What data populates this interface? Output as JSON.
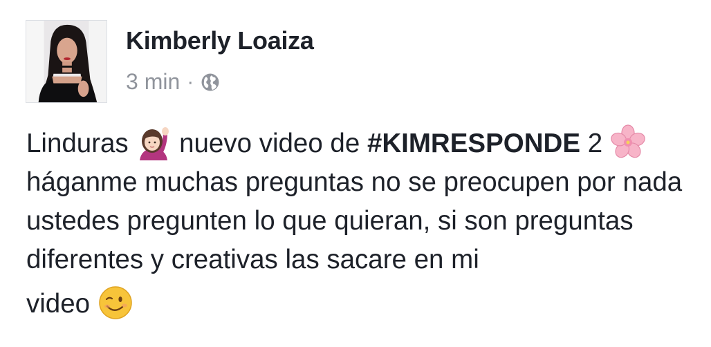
{
  "post": {
    "author": "Kimberly Loaiza",
    "time": "3 min",
    "separator": "·",
    "privacy_icon": "globe-icon",
    "text": {
      "part1": "Linduras",
      "emoji1": "person-raising-hand-emoji",
      "part2": "nuevo video de",
      "hashtag": "#KIMRESPONDE",
      "part3": "2",
      "emoji2": "cherry-blossom-emoji",
      "part4": "háganme muchas preguntas no se preocupen por nada ustedes pregunten lo que quieran, si son preguntas diferentes y creativas las sacare en mi",
      "part5": "video",
      "emoji3": "winking-face-emoji"
    }
  },
  "colors": {
    "name": "#1d2129",
    "meta": "#90949c",
    "text": "#1d2129"
  }
}
